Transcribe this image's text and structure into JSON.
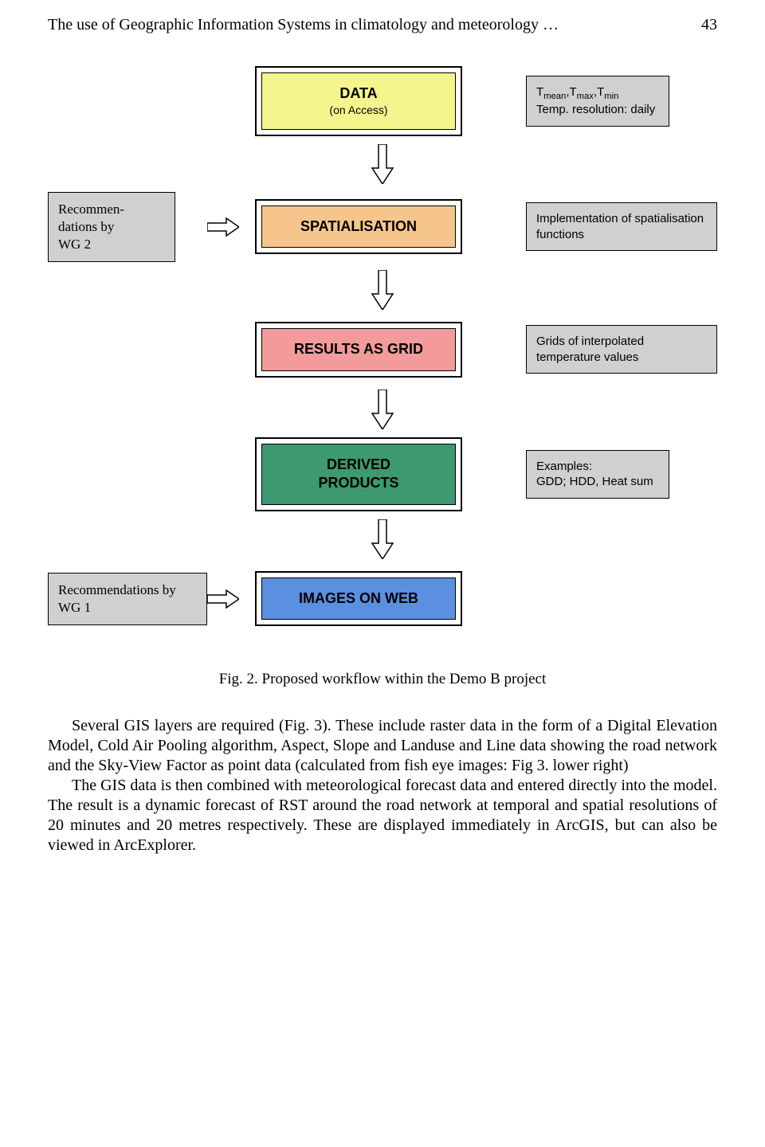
{
  "header": {
    "title": "The use of Geographic Information Systems in climatology and meteorology …",
    "page_number": "43"
  },
  "diagram": {
    "data": {
      "title": "DATA",
      "subtitle": "(on Access)"
    },
    "data_note": {
      "line1_html": "T<sub>mean</sub>,T<sub>max</sub>,T<sub>min</sub>",
      "line1_plain": "Tmean,Tmax,Tmin",
      "line2": "Temp. resolution: daily"
    },
    "spatialisation": {
      "title": "SPATIALISATION"
    },
    "spatialisation_left": "Recommen-dations by WG 2",
    "spatialisation_right": "Implementation of spatialisation functions",
    "results": {
      "title": "RESULTS AS GRID"
    },
    "results_right": "Grids of interpolated temperature values",
    "derived": {
      "title": "DERIVED PRODUCTS"
    },
    "derived_right_line1": "Examples:",
    "derived_right_line2": "GDD; HDD, Heat sum",
    "images": {
      "title": "IMAGES ON WEB"
    },
    "images_left": "Recommendations by WG 1"
  },
  "caption": "Fig. 2. Proposed workflow within the Demo B project",
  "body": {
    "p1": "Several GIS layers are required (Fig. 3). These include raster data in the form of a Digital Elevation Model, Cold Air Pooling algorithm, Aspect, Slope and Landuse and Line data showing the road network and the Sky-View Factor as point data (calculated from fish eye images: Fig 3. lower right)",
    "p2": "The GIS data is then combined with meteorological forecast data and entered directly into the model. The result is a dynamic forecast of RST around the road network at temporal and spatial resolutions of 20 minutes and 20 metres respectively. These are displayed immediately in ArcGIS, but can also be viewed in ArcExplorer."
  }
}
